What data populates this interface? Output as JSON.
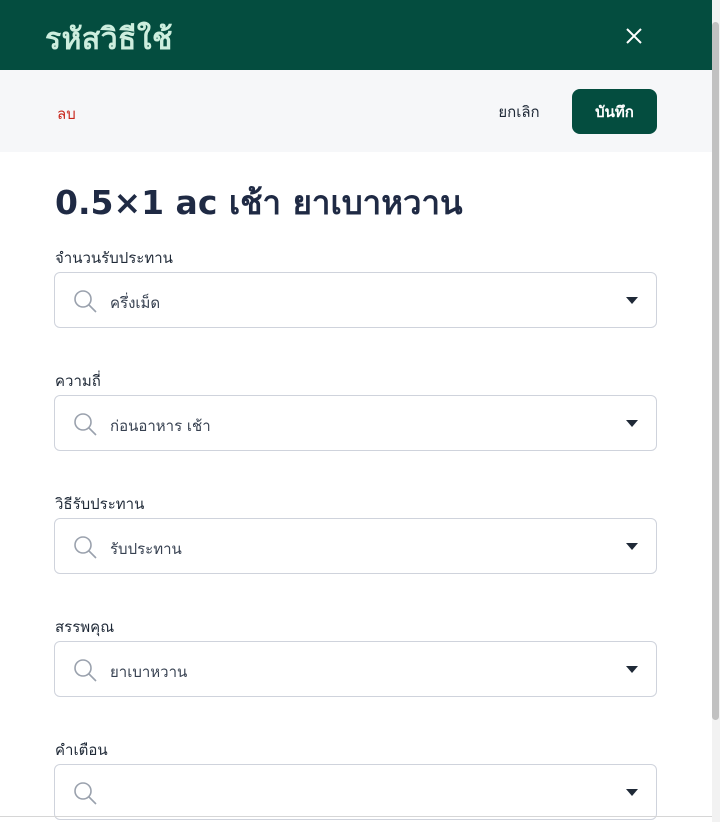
{
  "header": {
    "title": "รหัสวิธีใช้",
    "close_icon": "close-icon"
  },
  "toolbar": {
    "delete_label": "ลบ",
    "cancel_label": "ยกเลิก",
    "save_label": "บันทึก"
  },
  "main": {
    "title": "0.5×1 ac เช้า ยาเบาหวาน"
  },
  "fields": [
    {
      "label": "จำนวนรับประทาน",
      "value": "ครึ่งเม็ด"
    },
    {
      "label": "ความถี่",
      "value": "ก่อนอาหาร เช้า"
    },
    {
      "label": "วิธีรับประทาน",
      "value": "รับประทาน"
    },
    {
      "label": "สรรพคุณ",
      "value": "ยาเบาหวาน"
    },
    {
      "label": "คำเตือน",
      "value": ""
    }
  ],
  "colors": {
    "brand": "#044d3f",
    "header_title": "#cdeede",
    "danger": "#c8261c"
  }
}
